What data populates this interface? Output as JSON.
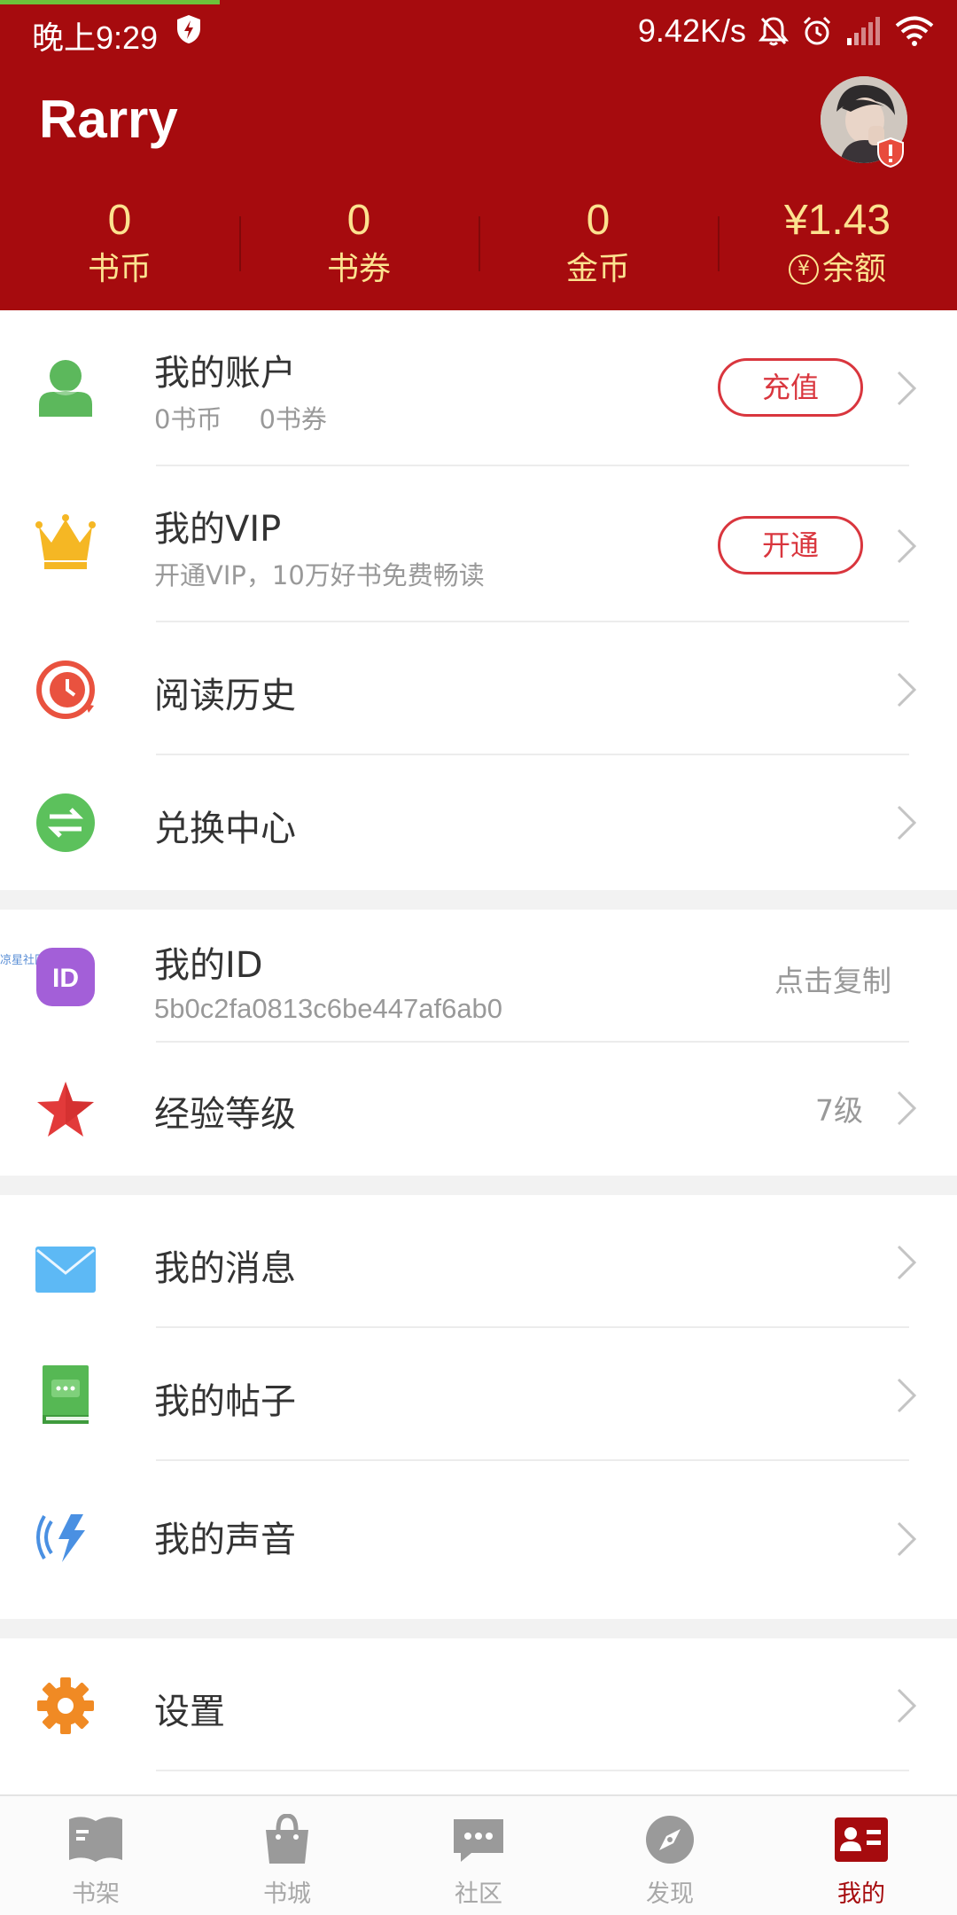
{
  "status_bar": {
    "time": "晚上9:29",
    "net_speed": "9.42K/s"
  },
  "header": {
    "user_name": "Rarry",
    "stats": [
      {
        "value": "0",
        "label": "书币"
      },
      {
        "value": "0",
        "label": "书券"
      },
      {
        "value": "0",
        "label": "金币"
      },
      {
        "value": "¥1.43",
        "label": "余额",
        "label_prefix": "¥"
      }
    ]
  },
  "section1": {
    "account": {
      "title": "我的账户",
      "sub_coins": "0书币",
      "sub_tickets": "0书券",
      "button": "充值"
    },
    "vip": {
      "title": "我的VIP",
      "sub": "开通VIP，10万好书免费畅读",
      "button": "开通"
    },
    "history": {
      "title": "阅读历史"
    },
    "exchange": {
      "title": "兑换中心"
    }
  },
  "section2": {
    "id": {
      "title": "我的ID",
      "value": "5b0c2fa0813c6be447af6ab0",
      "action": "点击复制",
      "watermark": "凉星社区"
    },
    "level": {
      "title": "经验等级",
      "value": "7级"
    }
  },
  "section3": {
    "messages": {
      "title": "我的消息"
    },
    "posts": {
      "title": "我的帖子"
    },
    "voice": {
      "title": "我的声音"
    }
  },
  "section4": {
    "settings": {
      "title": "设置"
    }
  },
  "bottom_nav": [
    {
      "label": "书架",
      "icon": "bookshelf-icon"
    },
    {
      "label": "书城",
      "icon": "shopping-bag-icon"
    },
    {
      "label": "社区",
      "icon": "chat-bubble-icon"
    },
    {
      "label": "发现",
      "icon": "compass-icon"
    },
    {
      "label": "我的",
      "icon": "profile-card-icon",
      "active": true
    }
  ],
  "colors": {
    "brand_red": "#a60b0e",
    "stat_gold": "#fce28f",
    "button_red": "#d9363e",
    "progress_green": "#6cc23a"
  }
}
